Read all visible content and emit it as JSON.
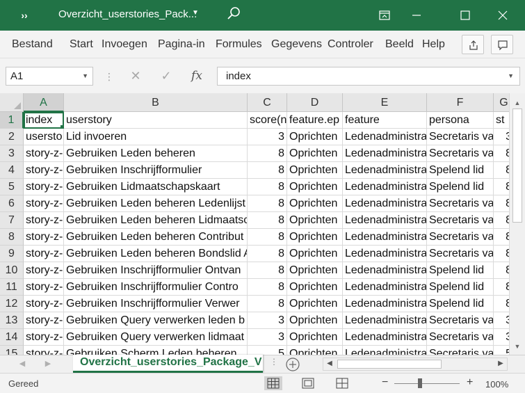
{
  "window": {
    "title": "Overzicht_userstories_Pack...",
    "qat_label": "››"
  },
  "ribbon": {
    "tabs": [
      "Bestand",
      "Start",
      "Invoegen",
      "Pagina-in",
      "Formules",
      "Gegevens",
      "Controler",
      "Beeld",
      "Help"
    ]
  },
  "formula_bar": {
    "name_box": "A1",
    "formula": "index",
    "fx_label": "fx"
  },
  "columns": [
    "A",
    "B",
    "C",
    "D",
    "E",
    "F",
    "G"
  ],
  "rows": [
    {
      "num": "1",
      "cells": [
        "index",
        "userstory",
        "score(n",
        "feature.ep",
        "feature",
        "persona",
        "st"
      ]
    },
    {
      "num": "2",
      "cells": [
        "usersto",
        "Lid invoeren",
        "3",
        "Oprichten",
        "Ledenadministra",
        "Secretaris va",
        "3"
      ]
    },
    {
      "num": "3",
      "cells": [
        "story-z-",
        "Gebruiken Leden beheren",
        "8",
        "Oprichten",
        "Ledenadministra",
        "Secretaris va",
        "8"
      ]
    },
    {
      "num": "4",
      "cells": [
        "story-z-",
        "Gebruiken Inschrijfformulier",
        "8",
        "Oprichten",
        "Ledenadministra",
        "Spelend lid",
        "8"
      ]
    },
    {
      "num": "5",
      "cells": [
        "story-z-",
        "Gebruiken Lidmaatschapskaart",
        "8",
        "Oprichten",
        "Ledenadministra",
        "Spelend lid",
        "8"
      ]
    },
    {
      "num": "6",
      "cells": [
        "story-z-",
        "Gebruiken Leden beheren Ledenlijst",
        "8",
        "Oprichten",
        "Ledenadministra",
        "Secretaris va",
        "8"
      ]
    },
    {
      "num": "7",
      "cells": [
        "story-z-",
        "Gebruiken Leden beheren Lidmaatsc",
        "8",
        "Oprichten",
        "Ledenadministra",
        "Secretaris va",
        "8"
      ]
    },
    {
      "num": "8",
      "cells": [
        "story-z-",
        "Gebruiken Leden beheren Contribut",
        "8",
        "Oprichten",
        "Ledenadministra",
        "Secretaris va",
        "8"
      ]
    },
    {
      "num": "9",
      "cells": [
        "story-z-",
        "Gebruiken Leden beheren Bondslid A",
        "8",
        "Oprichten",
        "Ledenadministra",
        "Secretaris va",
        "8"
      ]
    },
    {
      "num": "10",
      "cells": [
        "story-z-",
        "Gebruiken Inschrijfformulier Ontvan",
        "8",
        "Oprichten",
        "Ledenadministra",
        "Spelend lid",
        "8"
      ]
    },
    {
      "num": "11",
      "cells": [
        "story-z-",
        "Gebruiken Inschrijfformulier Contro",
        "8",
        "Oprichten",
        "Ledenadministra",
        "Spelend lid",
        "8"
      ]
    },
    {
      "num": "12",
      "cells": [
        "story-z-",
        "Gebruiken Inschrijfformulier Verwer",
        "8",
        "Oprichten",
        "Ledenadministra",
        "Spelend lid",
        "8"
      ]
    },
    {
      "num": "13",
      "cells": [
        "story-z-",
        "Gebruiken Query verwerken leden b",
        "3",
        "Oprichten",
        "Ledenadministra",
        "Secretaris va",
        "3"
      ]
    },
    {
      "num": "14",
      "cells": [
        "story-z-",
        "Gebruiken Query verwerken lidmaat",
        "3",
        "Oprichten",
        "Ledenadministra",
        "Secretaris va",
        "3"
      ]
    },
    {
      "num": "15",
      "cells": [
        "story-z-",
        "Gebruiken Scherm Leden beheren",
        "5",
        "Oprichten",
        "Ledenadministra",
        "Secretaris va",
        "5"
      ]
    }
  ],
  "sheet_tab": "Overzicht_userstories_Package_V",
  "status": {
    "text": "Gereed",
    "zoom": "100%",
    "zoom_minus": "−",
    "zoom_plus": "+"
  },
  "colors": {
    "accent": "#217346",
    "header_bg": "#e6e6e6",
    "gridline": "#dadada"
  },
  "icons": [
    "qat-expand-icon",
    "title-dropdown-icon",
    "search-icon",
    "ribbon-display-icon",
    "minimize-icon",
    "maximize-icon",
    "close-icon",
    "share-icon",
    "comments-icon",
    "cancel-icon",
    "enter-icon",
    "insert-function-icon",
    "add-sheet-icon",
    "normal-view-icon",
    "page-layout-view-icon",
    "page-break-view-icon"
  ]
}
